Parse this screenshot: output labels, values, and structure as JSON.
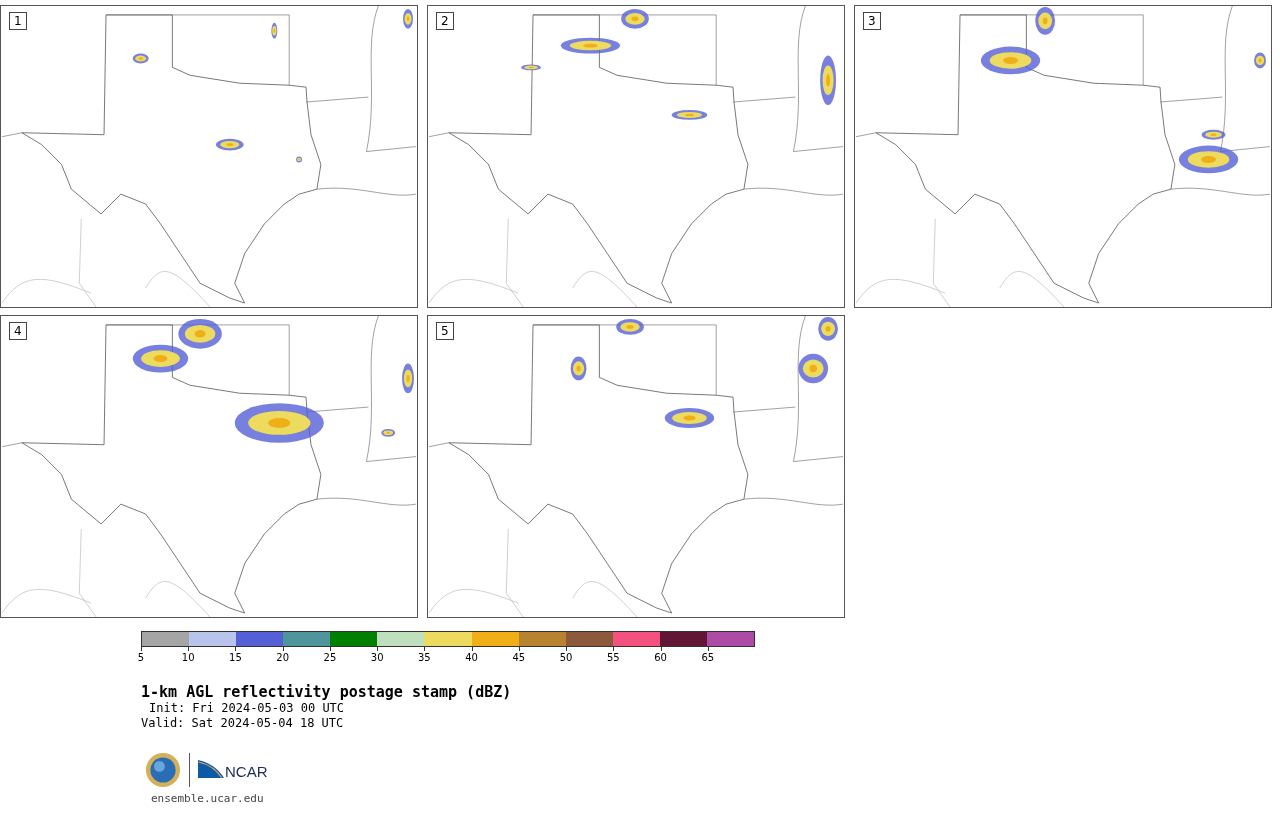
{
  "panels": [
    {
      "label": "1"
    },
    {
      "label": "2"
    },
    {
      "label": "3"
    },
    {
      "label": "4"
    },
    {
      "label": "5"
    }
  ],
  "colorbar": {
    "bins": [
      {
        "color": "#a5a5a5"
      },
      {
        "color": "#b8c4ec"
      },
      {
        "color": "#5560d6"
      },
      {
        "color": "#4e969c"
      },
      {
        "color": "#008000"
      },
      {
        "color": "#bfdfbf"
      },
      {
        "color": "#ecdb5e"
      },
      {
        "color": "#f0ae17"
      },
      {
        "color": "#b88330"
      },
      {
        "color": "#8c593c"
      },
      {
        "color": "#f45180"
      },
      {
        "color": "#621636"
      },
      {
        "color": "#ac4ca4"
      }
    ],
    "ticks": [
      "5",
      "10",
      "15",
      "20",
      "25",
      "30",
      "35",
      "40",
      "45",
      "50",
      "55",
      "60",
      "65"
    ]
  },
  "title": "1-km AGL reflectivity postage stamp (dBZ)",
  "init": "Init: Fri 2024-05-03 00 UTC",
  "valid": "Valid: Sat 2024-05-04 18 UTC",
  "logo": {
    "org": "NCAR"
  },
  "url": "ensemble.ucar.edu"
}
